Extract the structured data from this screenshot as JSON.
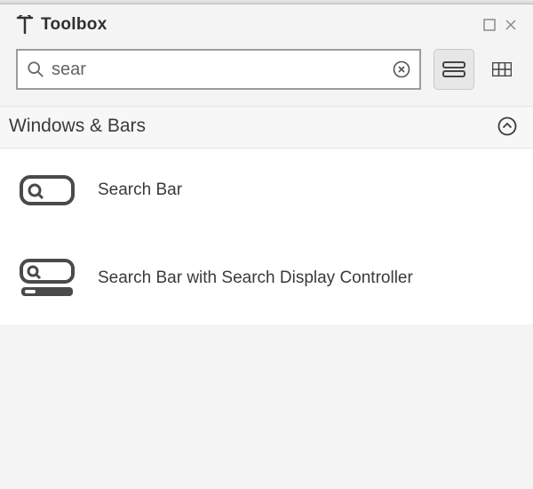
{
  "header": {
    "title": "Toolbox"
  },
  "search": {
    "value": "sear",
    "placeholder": ""
  },
  "section": {
    "title": "Windows & Bars"
  },
  "results": [
    {
      "name": "Search Bar"
    },
    {
      "name": "Search Bar with Search Display Controller"
    }
  ]
}
